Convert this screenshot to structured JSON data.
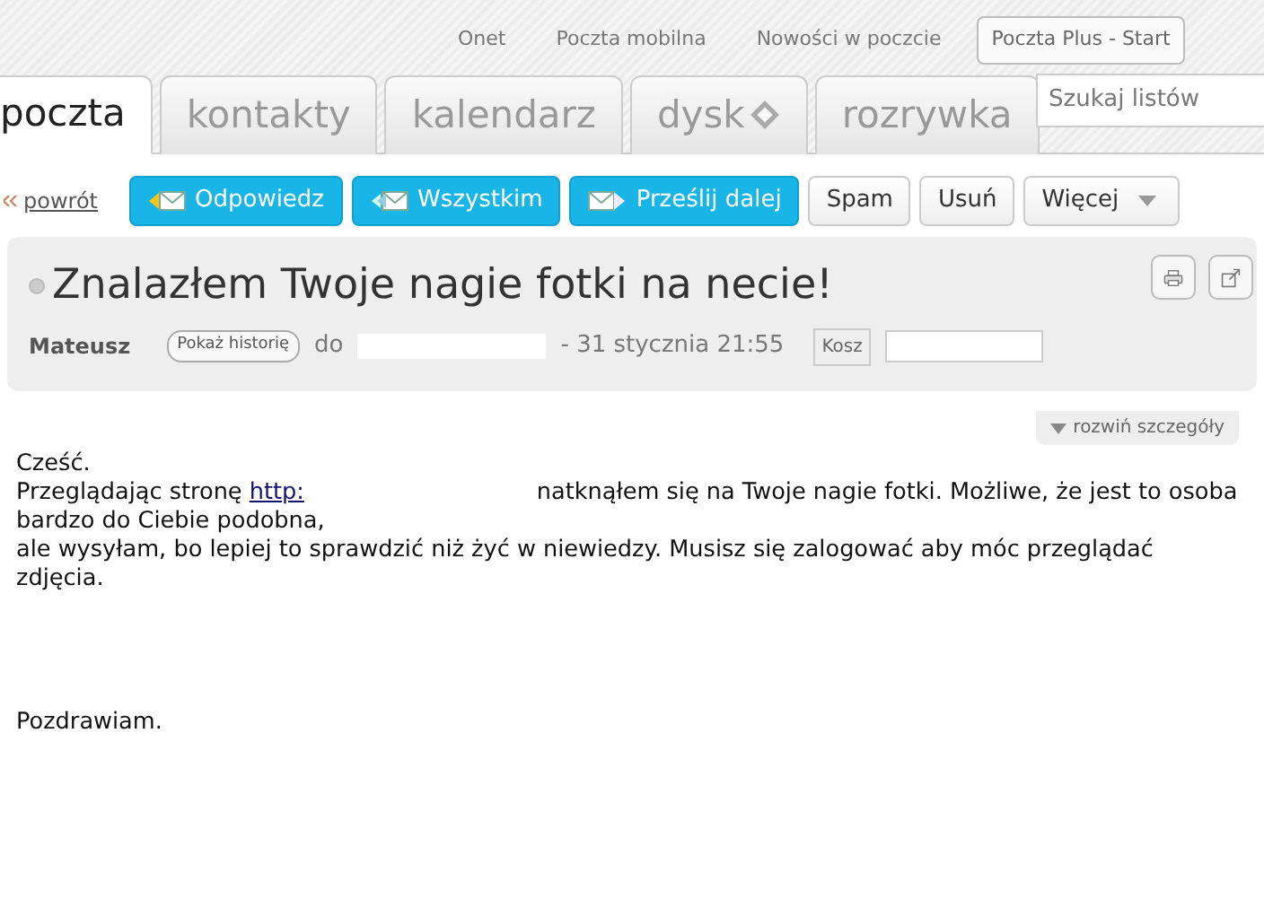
{
  "top_links": [
    "Onet",
    "Poczta mobilna",
    "Nowości w poczcie"
  ],
  "top_button": "Poczta Plus - Start",
  "tabs": [
    {
      "label": "poczta",
      "selected": true
    },
    {
      "label": "kontakty",
      "selected": false
    },
    {
      "label": "kalendarz",
      "selected": false
    },
    {
      "label": "dysk",
      "selected": false,
      "kind": "with_icon"
    },
    {
      "label": "rozrywka",
      "selected": false
    }
  ],
  "search": {
    "placeholder": "Szukaj listów"
  },
  "back_link": "powrót",
  "actions": [
    {
      "label": "Odpowiedz",
      "kind": "primary"
    },
    {
      "label": "Wszystkim",
      "kind": "primary"
    },
    {
      "label": "Prześlij dalej",
      "kind": "primary"
    },
    {
      "label": "Spam",
      "kind": "plain"
    },
    {
      "label": "Usuń",
      "kind": "plain"
    },
    {
      "label": "Więcej",
      "kind": "dropdown"
    }
  ],
  "message": {
    "subject": "Znalazłem Twoje nagie fotki na necie!",
    "sender": "Mateusz",
    "history_button": "Pokaż historię",
    "to_label": "do",
    "date": "- 31 stycznia 21:55",
    "folder": "Kosz",
    "details_toggle": "rozwiń szczegóły",
    "body": [
      {
        "kind": "text",
        "text": "Cześć."
      },
      {
        "kind": "link_line",
        "before": "Przeglądając stronę ",
        "link": "http:",
        "after": "natknąłem się na Twoje nagie fotki. Możliwe, że jest to osoba bardzo do Ciebie podobna,"
      },
      {
        "kind": "text",
        "text": "ale wysyłam, bo lepiej to sprawdzić niż żyć w niewiedzy. Musisz się zalogować aby móc przeglądać zdjęcia."
      },
      {
        "kind": "gap"
      },
      {
        "kind": "text",
        "text": "Pozdrawiam."
      }
    ]
  }
}
